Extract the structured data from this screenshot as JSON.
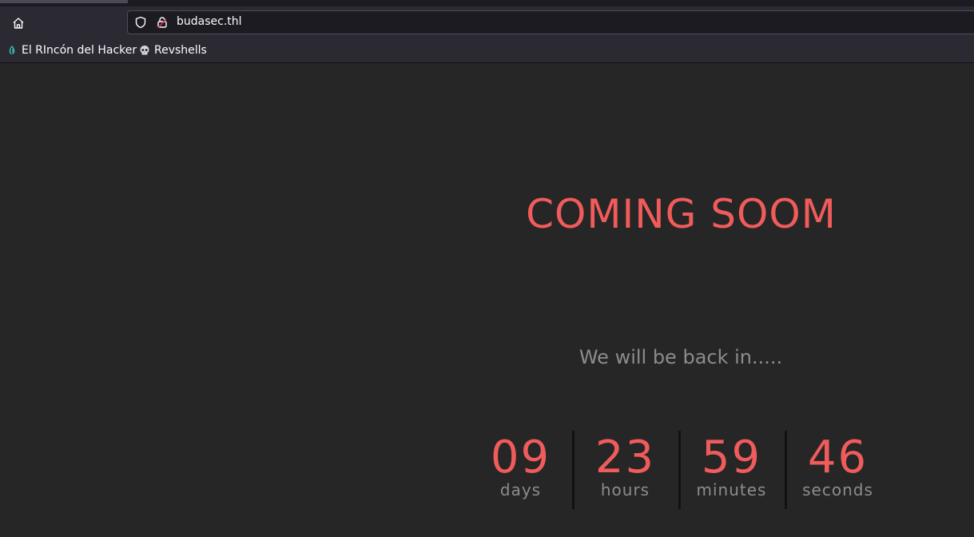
{
  "browser": {
    "url": "budasec.thl",
    "bookmarks": [
      {
        "label": "El RIncón del Hacker",
        "icon": "hacker-corner-icon"
      },
      {
        "label": "Revshells",
        "icon": "skull-icon"
      }
    ]
  },
  "page": {
    "headline": "COMING SOOM",
    "subline": "We will be back in.....",
    "countdown": {
      "days": {
        "value": "09",
        "label": "days"
      },
      "hours": {
        "value": "23",
        "label": "hours"
      },
      "minutes": {
        "value": "59",
        "label": "minutes"
      },
      "seconds": {
        "value": "46",
        "label": "seconds"
      }
    }
  },
  "colors": {
    "accent": "#f05b5b",
    "muted_text": "#8c8c8c",
    "page_bg": "#262626",
    "toolbar_bg": "#2b2a33"
  }
}
